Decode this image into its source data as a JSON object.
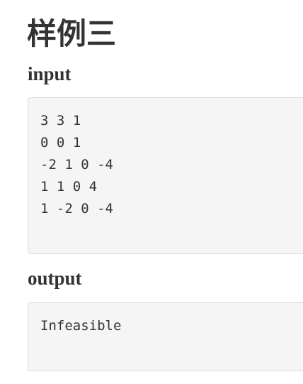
{
  "page": {
    "title": "样例三"
  },
  "input_section": {
    "heading": "input",
    "lines": [
      "3 3 1",
      "0 0 1",
      "-2 1 0 -4",
      "1 1 0 4",
      "1 -2 0 -4"
    ]
  },
  "output_section": {
    "heading": "output",
    "lines": [
      "Infeasible"
    ]
  }
}
